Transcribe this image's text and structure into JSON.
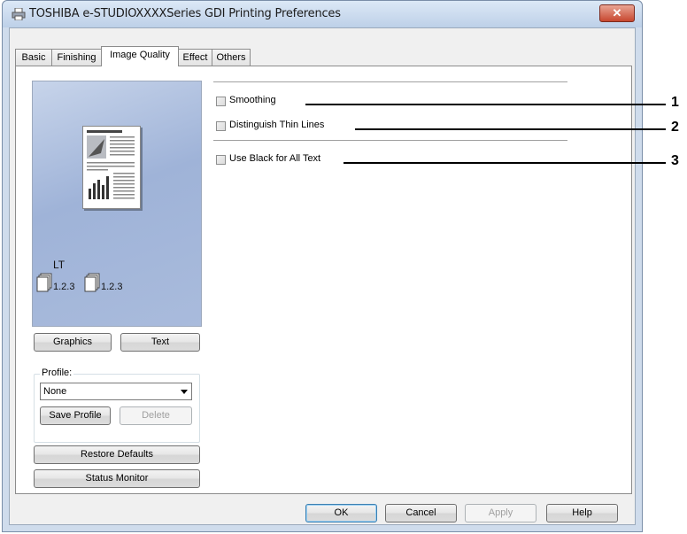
{
  "window": {
    "title": "TOSHIBA e-STUDIOXXXXSeries GDI Printing Preferences",
    "close_label": "✕"
  },
  "tabs": [
    {
      "label": "Basic"
    },
    {
      "label": "Finishing"
    },
    {
      "label": "Image Quality"
    },
    {
      "label": "Effect"
    },
    {
      "label": "Others"
    }
  ],
  "preview": {
    "paper_size": "LT",
    "page_order_1": "1.2.3",
    "page_order_2": "1.2.3"
  },
  "buttons": {
    "graphics": "Graphics",
    "text": "Text",
    "save_profile": "Save Profile",
    "delete": "Delete",
    "restore_defaults": "Restore Defaults",
    "status_monitor": "Status Monitor"
  },
  "profile": {
    "label": "Profile:",
    "selected": "None"
  },
  "options": [
    {
      "label": "Smoothing",
      "checked": false
    },
    {
      "label": "Distinguish Thin Lines",
      "checked": false
    },
    {
      "label": "Use Black for All Text",
      "checked": false
    }
  ],
  "callouts": [
    "1",
    "2",
    "3"
  ],
  "dialog_buttons": {
    "ok": "OK",
    "cancel": "Cancel",
    "apply": "Apply",
    "help": "Help"
  }
}
